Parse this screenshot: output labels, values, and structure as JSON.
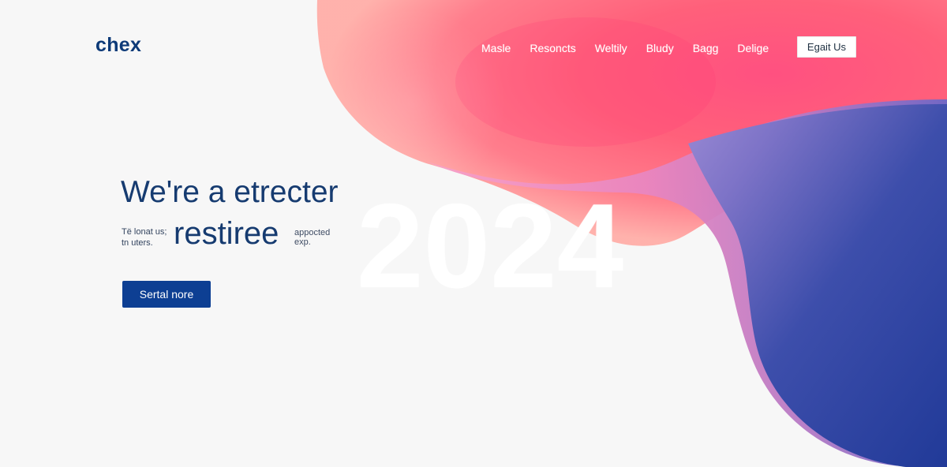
{
  "brand": {
    "name": "chex"
  },
  "nav": {
    "items": [
      {
        "label": "Masle"
      },
      {
        "label": "Resoncts"
      },
      {
        "label": "Weltily"
      },
      {
        "label": "Bludy"
      },
      {
        "label": "Bagg"
      },
      {
        "label": "Delige"
      }
    ],
    "button": {
      "label": "Egait Us"
    }
  },
  "hero": {
    "title": "We're a etrecter",
    "left_copy_line_1": "Të lonat us;",
    "left_copy_line_2": "tn uters.",
    "subtitle": "restiree",
    "right_copy_line_1": "appocted",
    "right_copy_line_2": "exp.",
    "year": "2024",
    "cta_label": "Sertal nore"
  },
  "colors": {
    "primary_blue": "#0d3f93",
    "heading_blue": "#163b70",
    "coral": "#ff5d7a",
    "pink": "#f17fbd",
    "indigo": "#243a9a"
  },
  "icons": {}
}
